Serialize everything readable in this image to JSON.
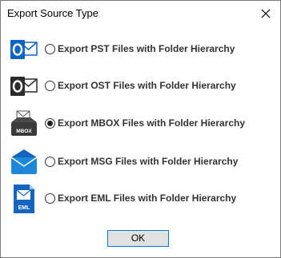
{
  "window": {
    "title": "Export Source Type",
    "close_icon": "close-icon"
  },
  "options": [
    {
      "label": "Export PST Files with Folder Hierarchy",
      "icon": "outlook-pst-icon",
      "checked": false
    },
    {
      "label": "Export OST Files with Folder Hierarchy",
      "icon": "outlook-ost-icon",
      "checked": false
    },
    {
      "label": "Export MBOX Files with Folder Hierarchy",
      "icon": "mbox-icon",
      "icon_text": "MBOX",
      "checked": true
    },
    {
      "label": "Export MSG Files with Folder Hierarchy",
      "icon": "msg-envelope-icon",
      "checked": false
    },
    {
      "label": "Export EML Files with Folder Hierarchy",
      "icon": "eml-file-icon",
      "icon_text": "EML",
      "checked": false
    }
  ],
  "ok_label": "OK",
  "colors": {
    "outlook_blue": "#0a64c8",
    "ost_dark": "#2b2b2b",
    "msg_blue": "#1e88d8",
    "eml_blue": "#1565c0",
    "ok_border": "#0078d7"
  }
}
